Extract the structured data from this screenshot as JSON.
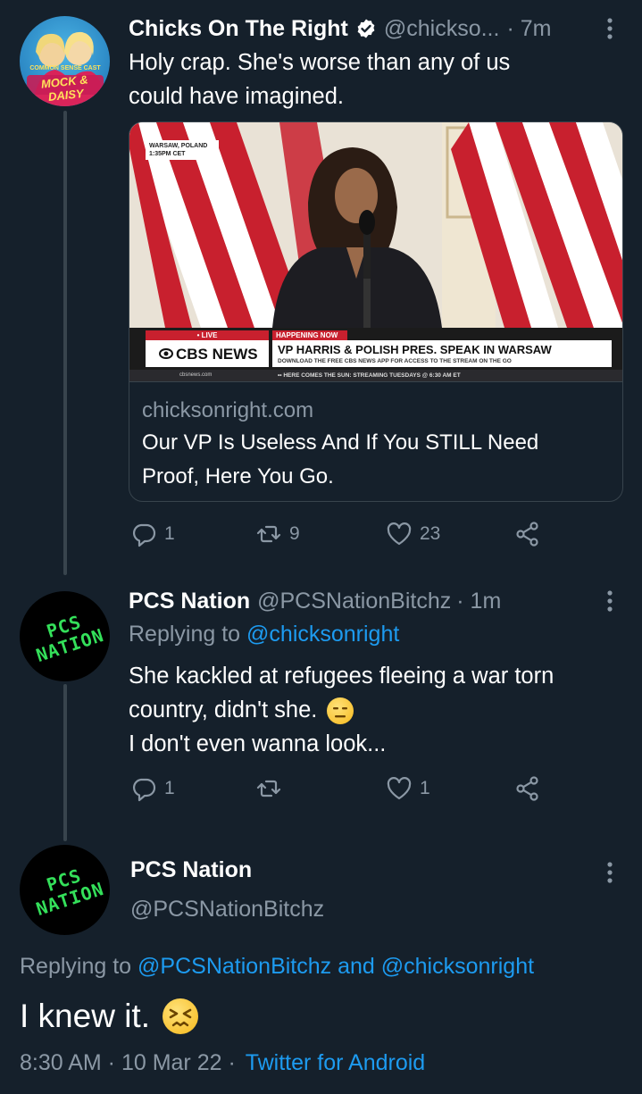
{
  "tweet1": {
    "display_name": "Chicks On The Right",
    "handle": "@chickso...",
    "time": "· 7m",
    "text_line1": "Holy crap.  She's worse than any of us",
    "text_line2": "could have imagined.",
    "avatar_label_top": "COMMON SENSE CAST",
    "avatar_label_bottom": "MOCK & DAISY",
    "card": {
      "location_line1": "WARSAW, POLAND",
      "location_line2": "1:35PM CET",
      "live_label": "• LIVE",
      "network": "CBS NEWS",
      "happening_label": "HAPPENING NOW",
      "headline": "VP HARRIS & POLISH PRES. SPEAK IN WARSAW",
      "subline": "DOWNLOAD THE FREE CBS NEWS APP FOR ACCESS TO THE STREAM ON THE GO",
      "site_small": "cbsnews.com",
      "ticker": "•• HERE COMES THE SUN: STREAMING TUESDAYS @ 6:30 AM ET",
      "domain": "chicksonright.com",
      "title_line1": "Our VP Is Useless And If You STILL Need",
      "title_line2": "Proof, Here You Go."
    },
    "actions": {
      "replies": "1",
      "retweets": "9",
      "likes": "23"
    }
  },
  "tweet2": {
    "display_name": "PCS Nation",
    "handle": "@PCSNationBitchz",
    "time": "· 1m",
    "replying_prefix": "Replying to",
    "replying_to": "@chicksonright",
    "text_line1": "She kackled at refugees fleeing a war torn",
    "text_line2": "country, didn't she.",
    "text_line3": "I don't even wanna look...",
    "avatar_label_top": "PCS",
    "avatar_label_bottom": "NATION",
    "actions": {
      "replies": "1",
      "retweets": "",
      "likes": "1"
    }
  },
  "tweet3": {
    "display_name": "PCS Nation",
    "handle": "@PCSNationBitchz",
    "replying_prefix": "Replying to",
    "replying_to": "@PCSNationBitchz and @chicksonright",
    "text": "I knew it.",
    "time": "8:30 AM · 10 Mar 22 ·",
    "source": "Twitter for Android",
    "avatar_label_top": "PCS",
    "avatar_label_bottom": "NATION"
  },
  "colors": {
    "background": "#15202b",
    "muted": "#8b98a5",
    "link": "#1d9bf0",
    "divider": "#38444d",
    "logo_green": "#34e05a"
  },
  "icons": [
    "verified-badge-icon",
    "more-icon",
    "reply-icon",
    "retweet-icon",
    "like-icon",
    "share-icon",
    "expressionless-emoji-icon",
    "confounded-emoji-icon"
  ]
}
